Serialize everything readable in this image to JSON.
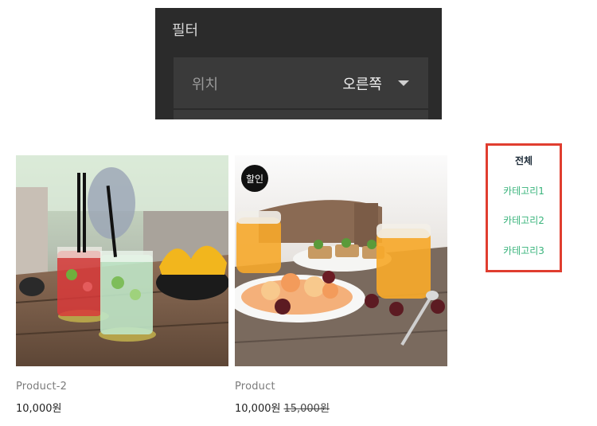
{
  "filter": {
    "title": "필터",
    "position_label": "위치",
    "position_value": "오른쪽"
  },
  "products": [
    {
      "name": "Product-2",
      "price": "10,000원",
      "image": "cocktails-on-table"
    },
    {
      "name": "Product",
      "price": "10,000원",
      "original_price": "15,000원",
      "badge": "할인",
      "image": "breakfast-table"
    }
  ],
  "categories": {
    "items": [
      "전체",
      "카테고리1",
      "카테고리2",
      "카테고리3"
    ],
    "active": "전체",
    "colors": {
      "active": "#1f2d3a",
      "item": "#3ab47c",
      "highlight_border": "#e03d2f"
    }
  }
}
